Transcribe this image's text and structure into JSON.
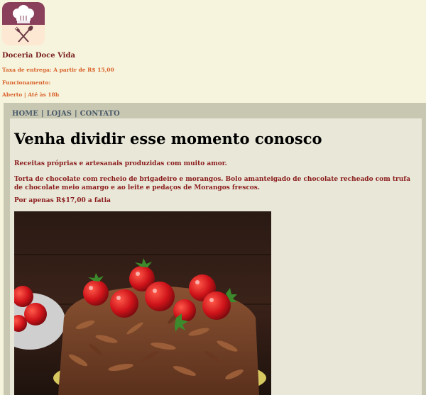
{
  "brand": {
    "logo_icon": "chef-hat-utensils-icon",
    "name": "Doceria Doce Vida",
    "delivery": "Taxa de entrega: A partir de R$ 15,00",
    "hours_label": "Funcionamento:",
    "hours_value": "Aberto | Até às 18h"
  },
  "nav": {
    "home": "HOME",
    "stores": "LOJAS",
    "contact": "CONTATO",
    "separator": "|"
  },
  "main": {
    "title": "Venha dividir esse momento conosco",
    "intro": "Receitas próprias e artesanais produzidas com muito amor.",
    "description": "Torta de chocolate com recheio de brigadeiro e morangos. Bolo amanteigado de chocolate recheado com trufa de chocolate meio amargo e ao leite e pedaços de Morangos frescos.",
    "price": "Por apenas R$17,00 a fatia",
    "image_icon": "chocolate-strawberry-cake-photo"
  },
  "colors": {
    "page_bg": "#f6f4dc",
    "frame_bg": "#c8c8b2",
    "content_bg": "#e8e7d8",
    "brand_text": "#7a1f1f",
    "info_text": "#d9602a",
    "nav_text": "#4a5a6a",
    "body_text": "#8a1a1a",
    "logo_top": "#8a3f5a",
    "logo_bottom": "#fde8d4"
  }
}
